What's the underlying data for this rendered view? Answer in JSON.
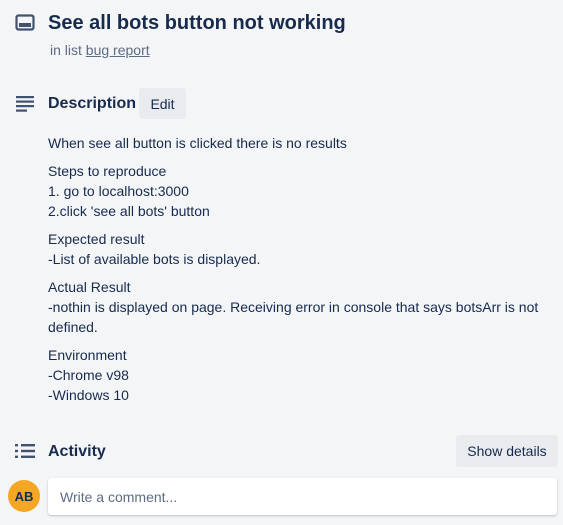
{
  "card": {
    "title": "See all bots button not working",
    "in_list_prefix": "in list",
    "list_name": "bug report"
  },
  "description": {
    "title": "Description",
    "edit_label": "Edit",
    "paragraphs": [
      "When see all button is clicked there is no results",
      "Steps to reproduce\n1. go to localhost:3000\n2.click 'see all bots' button",
      "Expected result\n-List of available bots is displayed.",
      "Actual Result\n-nothin is displayed on page. Receiving error in console that says botsArr is not defined.",
      "Environment\n-Chrome v98\n-Windows 10"
    ]
  },
  "activity": {
    "title": "Activity",
    "show_details_label": "Show details"
  },
  "comment": {
    "avatar_initials": "AB",
    "placeholder": "Write a comment..."
  },
  "colors": {
    "background": "#f4f5f7",
    "text": "#172b4d",
    "muted": "#5e6c84",
    "avatar": "#f5a623",
    "button": "#e9ebee"
  },
  "icons": {
    "card": "card-icon",
    "description": "description-lines-icon",
    "activity": "activity-list-icon"
  }
}
